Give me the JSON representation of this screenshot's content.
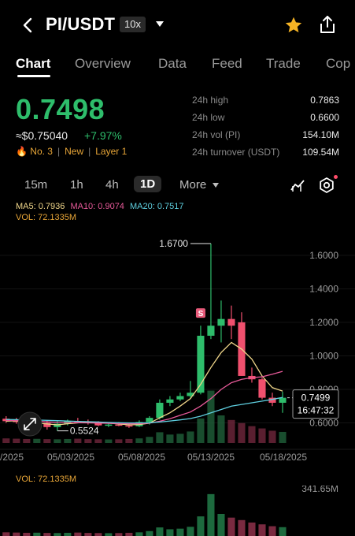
{
  "header": {
    "title": "PI/USDT",
    "leverage": "10x"
  },
  "tabs": [
    {
      "label": "Chart"
    },
    {
      "label": "Overview"
    },
    {
      "label": "Data"
    },
    {
      "label": "Feed"
    },
    {
      "label": "Trade"
    },
    {
      "label": "Cop"
    }
  ],
  "ticker": {
    "price": "0.7498",
    "fiat": "≈$0.75040",
    "change": "+7.97%",
    "rank": "No. 3",
    "tag_new": "New",
    "tag_layer": "Layer 1"
  },
  "stats": [
    {
      "label": "24h high",
      "value": "0.7863"
    },
    {
      "label": "24h low",
      "value": "0.6600"
    },
    {
      "label": "24h vol (PI)",
      "value": "154.10M"
    },
    {
      "label": "24h turnover (USDT)",
      "value": "109.54M"
    }
  ],
  "intervals": {
    "i15m": "15m",
    "i1h": "1h",
    "i4h": "4h",
    "i1d": "1D",
    "more": "More"
  },
  "indicators": {
    "ma5": "MA5: 0.7936",
    "ma10": "MA10: 0.9074",
    "ma20": "MA20: 0.7517",
    "vol": "VOL: 72.1335M",
    "vol_panel": "VOL: 72.1335M",
    "vol_max": "341.65M"
  },
  "colors": {
    "up": "#2ebd6b",
    "down": "#f0506e",
    "ma5": "#f0d68a",
    "ma10": "#e85a9a",
    "ma20": "#5fd0e0",
    "accent": "#f5b324"
  },
  "chart_data": {
    "type": "candlestick",
    "y_ticks": [
      "1.6000",
      "1.4000",
      "1.2000",
      "1.0000",
      "0.8000",
      "0.6000"
    ],
    "ylim": [
      0.48,
      1.75
    ],
    "x_ticks": [
      "/2025",
      "05/03/2025",
      "05/08/2025",
      "05/13/2025",
      "05/18/2025"
    ],
    "high_label": "1.6700",
    "low_label": "0.5524",
    "last_price": "0.7499",
    "countdown": "16:47:32",
    "candles": [
      {
        "o": 0.625,
        "h": 0.64,
        "l": 0.6,
        "c": 0.61
      },
      {
        "o": 0.615,
        "h": 0.63,
        "l": 0.595,
        "c": 0.605
      },
      {
        "o": 0.61,
        "h": 0.625,
        "l": 0.58,
        "c": 0.59
      },
      {
        "o": 0.59,
        "h": 0.62,
        "l": 0.57,
        "c": 0.605
      },
      {
        "o": 0.6,
        "h": 0.615,
        "l": 0.56,
        "c": 0.575
      },
      {
        "o": 0.575,
        "h": 0.61,
        "l": 0.5524,
        "c": 0.595
      },
      {
        "o": 0.595,
        "h": 0.62,
        "l": 0.585,
        "c": 0.61
      },
      {
        "o": 0.61,
        "h": 0.63,
        "l": 0.6,
        "c": 0.605
      },
      {
        "o": 0.605,
        "h": 0.62,
        "l": 0.59,
        "c": 0.6
      },
      {
        "o": 0.6,
        "h": 0.61,
        "l": 0.58,
        "c": 0.585
      },
      {
        "o": 0.585,
        "h": 0.6,
        "l": 0.575,
        "c": 0.59
      },
      {
        "o": 0.59,
        "h": 0.605,
        "l": 0.58,
        "c": 0.585
      },
      {
        "o": 0.585,
        "h": 0.6,
        "l": 0.57,
        "c": 0.58
      },
      {
        "o": 0.58,
        "h": 0.615,
        "l": 0.575,
        "c": 0.605
      },
      {
        "o": 0.605,
        "h": 0.64,
        "l": 0.59,
        "c": 0.63
      },
      {
        "o": 0.63,
        "h": 0.74,
        "l": 0.62,
        "c": 0.72
      },
      {
        "o": 0.72,
        "h": 0.76,
        "l": 0.7,
        "c": 0.74
      },
      {
        "o": 0.74,
        "h": 0.78,
        "l": 0.73,
        "c": 0.76
      },
      {
        "o": 0.76,
        "h": 0.85,
        "l": 0.75,
        "c": 0.78
      },
      {
        "o": 0.78,
        "h": 1.18,
        "l": 0.77,
        "c": 1.12
      },
      {
        "o": 1.12,
        "h": 1.67,
        "l": 1.1,
        "c": 1.18
      },
      {
        "o": 1.18,
        "h": 1.33,
        "l": 1.08,
        "c": 1.22
      },
      {
        "o": 1.22,
        "h": 1.3,
        "l": 1.1,
        "c": 1.18
      },
      {
        "o": 1.2,
        "h": 1.26,
        "l": 0.88,
        "c": 0.88
      },
      {
        "o": 0.88,
        "h": 0.93,
        "l": 0.84,
        "c": 0.86
      },
      {
        "o": 0.86,
        "h": 0.87,
        "l": 0.74,
        "c": 0.75
      },
      {
        "o": 0.75,
        "h": 0.78,
        "l": 0.7,
        "c": 0.72
      },
      {
        "o": 0.72,
        "h": 0.7863,
        "l": 0.66,
        "c": 0.7499
      }
    ],
    "ma5": [
      0.61,
      0.612,
      0.605,
      0.6,
      0.594,
      0.588,
      0.595,
      0.6,
      0.605,
      0.603,
      0.598,
      0.594,
      0.588,
      0.59,
      0.598,
      0.63,
      0.66,
      0.7,
      0.745,
      0.83,
      0.93,
      1.02,
      1.08,
      1.04,
      0.98,
      0.88,
      0.81,
      0.79
    ],
    "ma10": [
      0.615,
      0.614,
      0.612,
      0.61,
      0.606,
      0.603,
      0.602,
      0.601,
      0.6,
      0.599,
      0.597,
      0.596,
      0.595,
      0.595,
      0.598,
      0.61,
      0.625,
      0.645,
      0.665,
      0.7,
      0.745,
      0.8,
      0.84,
      0.86,
      0.87,
      0.875,
      0.89,
      0.9074
    ],
    "ma20": [
      0.62,
      0.619,
      0.618,
      0.617,
      0.615,
      0.613,
      0.611,
      0.609,
      0.607,
      0.605,
      0.603,
      0.601,
      0.6,
      0.6,
      0.601,
      0.605,
      0.611,
      0.618,
      0.626,
      0.64,
      0.66,
      0.68,
      0.7,
      0.71,
      0.72,
      0.73,
      0.74,
      0.7517
    ],
    "volume": [
      30,
      28,
      26,
      27,
      25,
      24,
      26,
      28,
      25,
      24,
      23,
      24,
      26,
      30,
      40,
      70,
      55,
      60,
      75,
      160,
      341.65,
      180,
      150,
      130,
      110,
      95,
      80,
      72.1335
    ],
    "vol_ylim": [
      0,
      360
    ]
  }
}
